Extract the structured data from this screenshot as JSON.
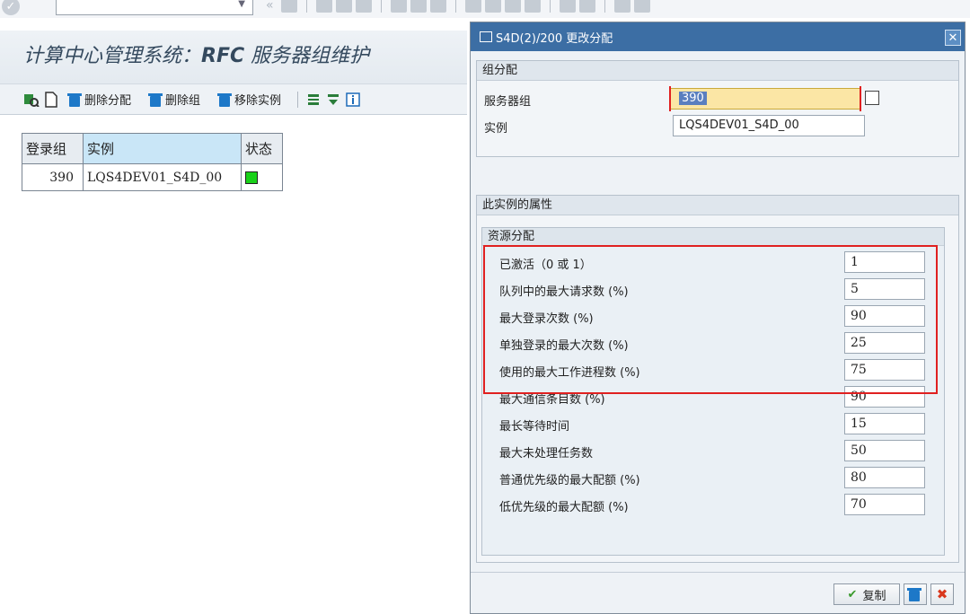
{
  "main": {
    "title_prefix": "计算中心管理系统：",
    "title_rfc": "RFC",
    "title_suffix": " 服务器组维护",
    "toolbar": {
      "delete_assignment": "删除分配",
      "delete_group": "删除组",
      "remove_instance": "移除实例"
    },
    "table": {
      "headers": [
        "登录组",
        "实例",
        "状态"
      ],
      "rows": [
        {
          "group": "390",
          "instance": "LQS4DEV01_S4D_00"
        }
      ]
    }
  },
  "dialog": {
    "title": "S4D(2)/200 更改分配",
    "group_assignment": {
      "header": "组分配",
      "server_group_label": "服务器组",
      "server_group_value": "390",
      "instance_label": "实例",
      "instance_value": "LQS4DEV01_S4D_00"
    },
    "properties": {
      "header": "此实例的属性",
      "sub_header": "资源分配",
      "rows": [
        {
          "label": "已激活（0 或 1）",
          "value": "1"
        },
        {
          "label": "队列中的最大请求数 (%)",
          "value": "5"
        },
        {
          "label": "最大登录次数 (%)",
          "value": "90"
        },
        {
          "label": "单独登录的最大次数 (%)",
          "value": "25"
        },
        {
          "label": "使用的最大工作进程数 (%)",
          "value": "75"
        },
        {
          "label": "最大通信条目数 (%)",
          "value": "90"
        },
        {
          "label": "最长等待时间",
          "value": "15"
        },
        {
          "label": "最大未处理任务数",
          "value": "50"
        },
        {
          "label": "普通优先级的最大配额 (%)",
          "value": "80"
        },
        {
          "label": "低优先级的最大配额 (%)",
          "value": "70"
        }
      ]
    },
    "footer": {
      "copy_label": "复制"
    }
  }
}
